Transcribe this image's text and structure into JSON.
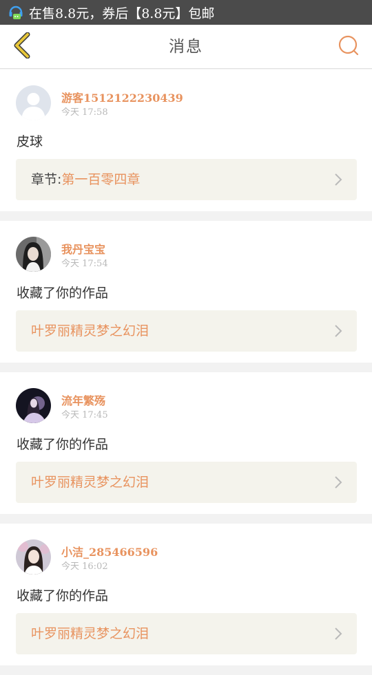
{
  "status_bar": {
    "notification_icon": "chat-bubble-icon",
    "notification_text": "在售8.8元，券后【8.8元】包邮"
  },
  "nav": {
    "back_icon": "chevron-left-icon",
    "title": "消息",
    "search_icon": "search-icon"
  },
  "messages": [
    {
      "username": "游客1512122230439",
      "time": "今天 17:58",
      "text": "皮球",
      "ref_label": "章节:",
      "ref_value": "第一百零四章",
      "avatar": "default-avatar-icon"
    },
    {
      "username": "我丹宝宝",
      "time": "今天 17:54",
      "text": "收藏了你的作品",
      "ref_label": "",
      "ref_value": "叶罗丽精灵梦之幻泪",
      "avatar": "user-photo-girl"
    },
    {
      "username": "流年繁殇",
      "time": "今天 17:45",
      "text": "收藏了你的作品",
      "ref_label": "",
      "ref_value": "叶罗丽精灵梦之幻泪",
      "avatar": "user-photo-dark"
    },
    {
      "username": "小洁_285466596",
      "time": "今天 16:02",
      "text": "收藏了你的作品",
      "ref_label": "",
      "ref_value": "叶罗丽精灵梦之幻泪",
      "avatar": "user-photo-girl-light"
    }
  ],
  "colors": {
    "accent": "#e8935f",
    "back_icon": "#e8c73a",
    "status_bar": "#4b4b4b",
    "ref_bg": "#f4f3ec"
  }
}
